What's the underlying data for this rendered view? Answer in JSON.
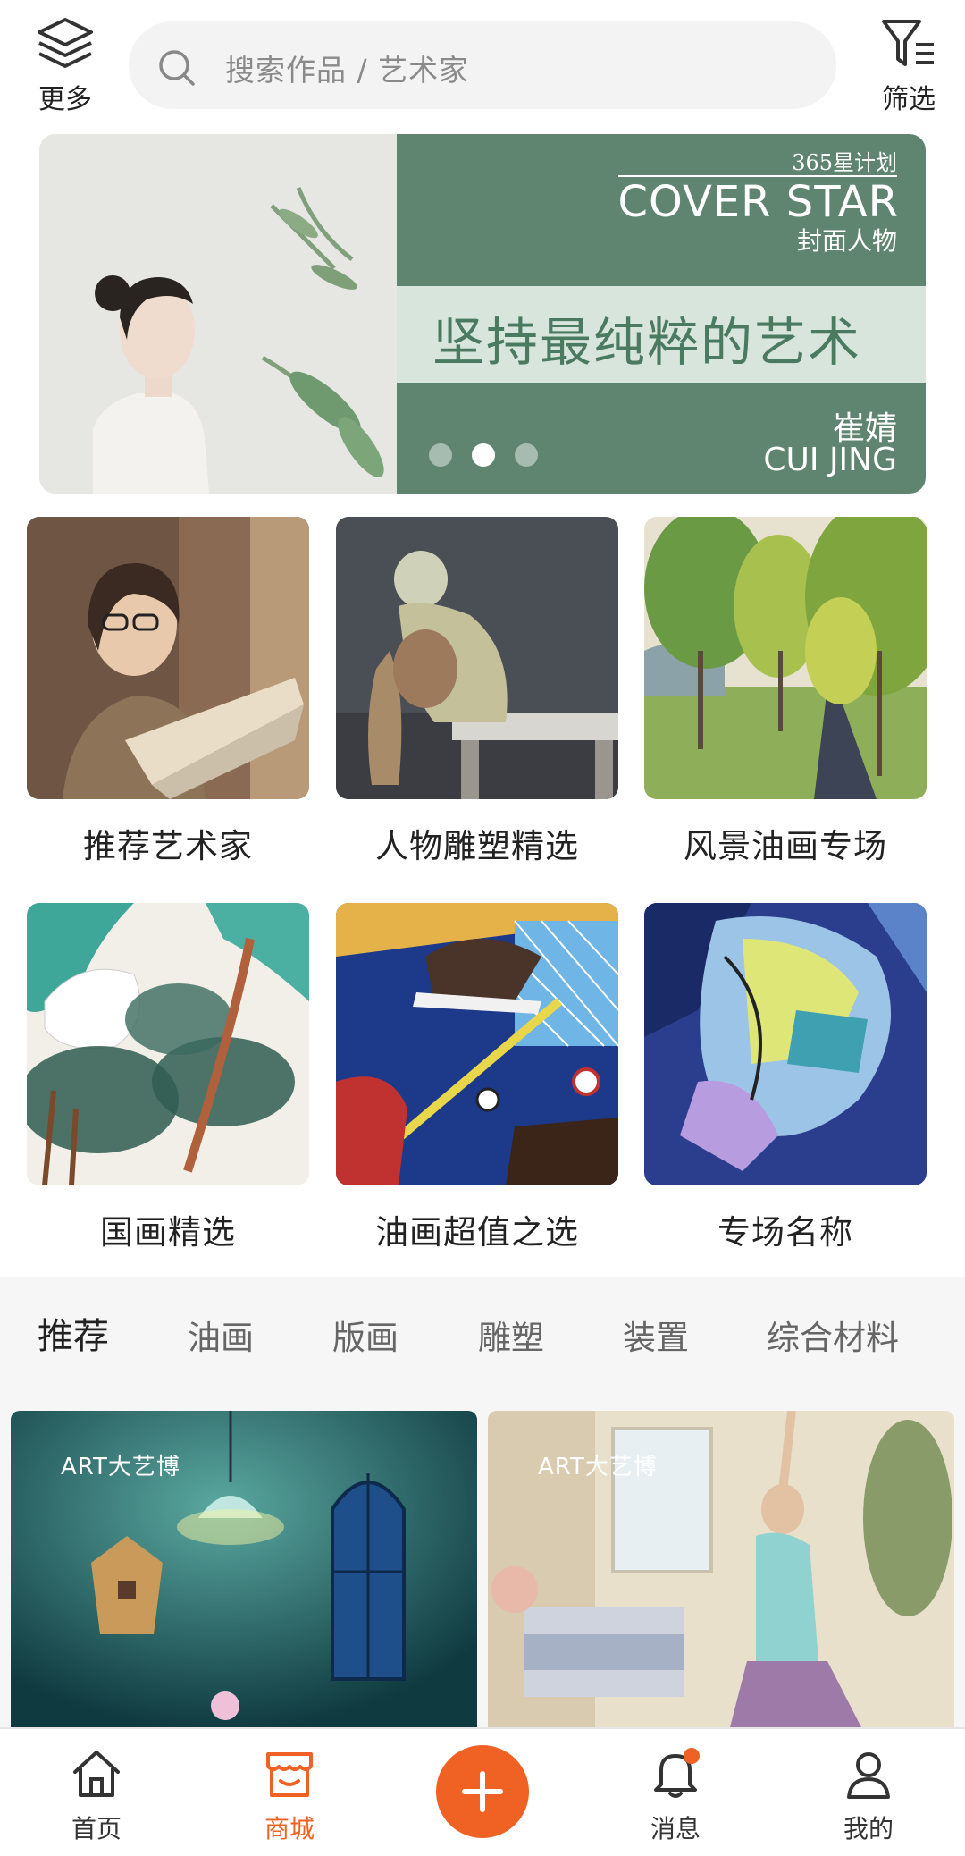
{
  "header": {
    "more_label": "更多",
    "search_placeholder": "搜索作品 / 艺术家",
    "filter_label": "筛选"
  },
  "banner": {
    "plan": "365星计划",
    "title_en": "COVER STAR",
    "title_cn": "封面人物",
    "slogan": "坚持最纯粹的艺术",
    "artist_cn": "崔婧",
    "artist_en": "CUI JING",
    "dot_count": 3,
    "active_dot": 2
  },
  "categories": [
    {
      "label": "推荐艺术家"
    },
    {
      "label": "人物雕塑精选"
    },
    {
      "label": "风景油画专场"
    },
    {
      "label": "国画精选"
    },
    {
      "label": "油画超值之选"
    },
    {
      "label": "专场名称"
    }
  ],
  "tabs": [
    {
      "label": "推荐",
      "active": true
    },
    {
      "label": "油画"
    },
    {
      "label": "版画"
    },
    {
      "label": "雕塑"
    },
    {
      "label": "装置"
    },
    {
      "label": "综合材料"
    }
  ],
  "cards": [
    {
      "brand": "ART大艺博"
    },
    {
      "brand": "ART大艺博"
    }
  ],
  "bottom_nav": {
    "home": "首页",
    "mall": "商城",
    "messages": "消息",
    "me": "我的",
    "active": "mall"
  },
  "colors": {
    "accent": "#f06224",
    "banner_green": "#5f8570",
    "notification_dot": "#f06224"
  }
}
